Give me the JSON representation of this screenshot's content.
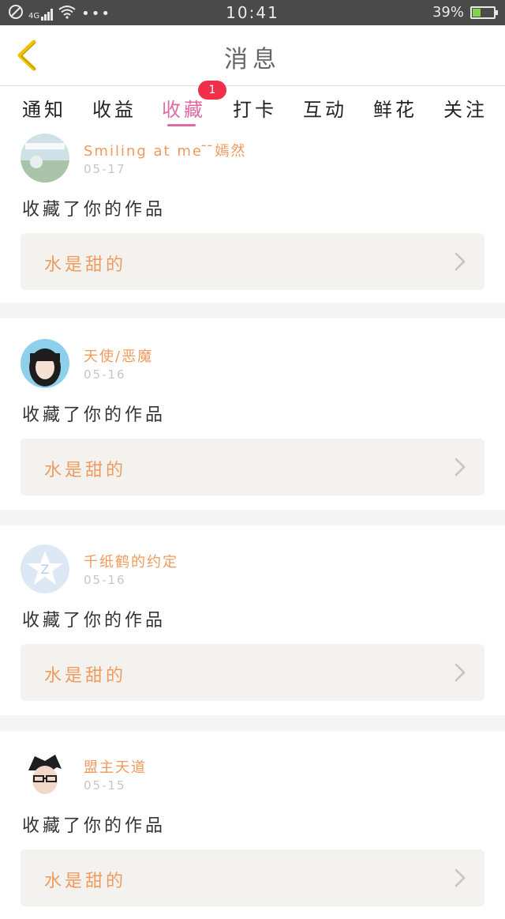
{
  "status_bar": {
    "signal": "4G",
    "time": "10:41",
    "battery_percent": "39%",
    "battery_level": 0.39
  },
  "header": {
    "title": "消息"
  },
  "tabs": [
    {
      "label": "通知"
    },
    {
      "label": "收益"
    },
    {
      "label": "收藏",
      "badge": "1",
      "active": true
    },
    {
      "label": "打卡"
    },
    {
      "label": "互动"
    },
    {
      "label": "鲜花"
    },
    {
      "label": "关注"
    }
  ],
  "feed": [
    {
      "user": "Smiling at me ̄ ̄嫣然",
      "date": "05-17",
      "action": "收藏了你的作品",
      "work": "水是甜的",
      "avatar": "landscape-photo-avatar"
    },
    {
      "user": "天使/恶魔",
      "date": "05-16",
      "action": "收藏了你的作品",
      "work": "水是甜的",
      "avatar": "girl-portrait-avatar"
    },
    {
      "user": "千纸鹤的约定",
      "date": "05-16",
      "action": "收藏了你的作品",
      "work": "水是甜的",
      "avatar": "default-star-avatar"
    },
    {
      "user": "盟主天道",
      "date": "05-15",
      "action": "收藏了你的作品",
      "work": "水是甜的",
      "avatar": "glasses-boy-avatar"
    }
  ],
  "colors": {
    "accent_pink": "#e06aa4",
    "orange_text": "#f09a5e",
    "badge_red": "#f0304a",
    "back_yellow": "#f2c200"
  }
}
